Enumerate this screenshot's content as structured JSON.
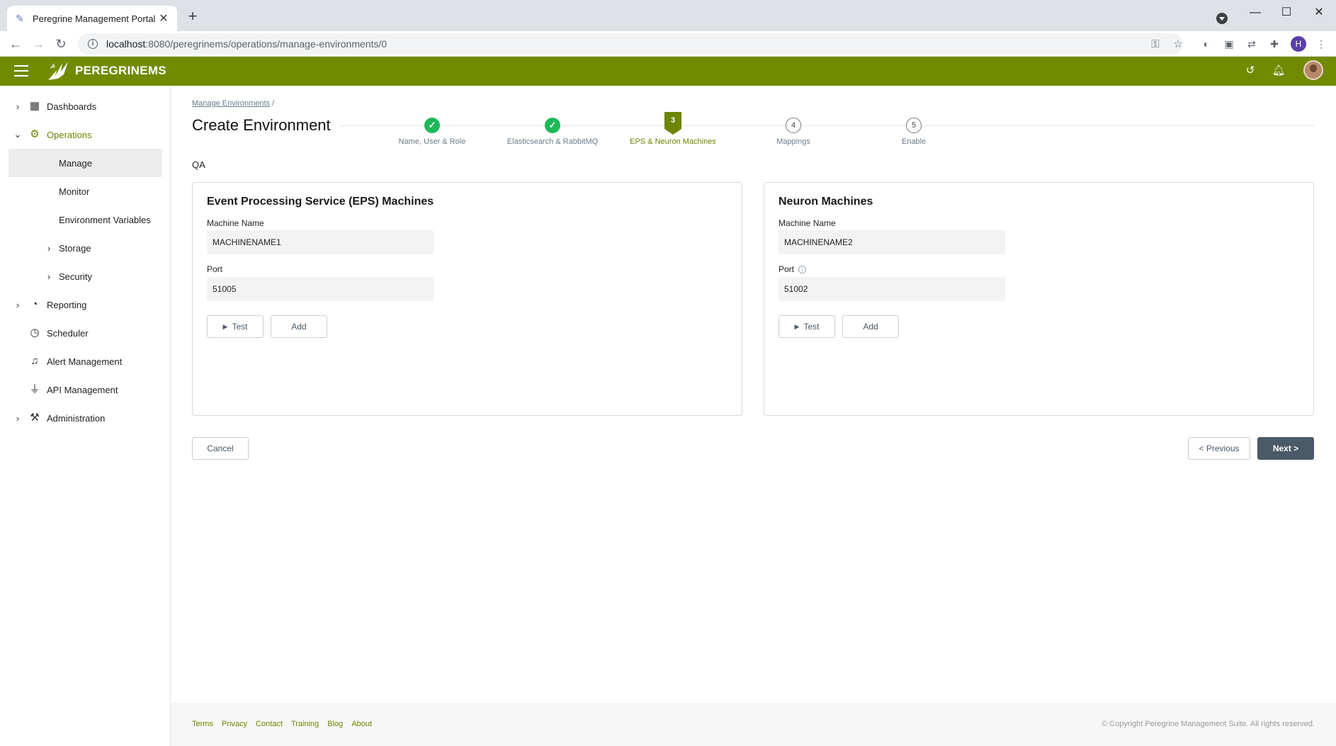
{
  "browser": {
    "tab_title": "Peregrine Management Portal",
    "tab_close": "✕",
    "new_tab": "+",
    "url_host": "localhost",
    "url_path": ":8080/peregrinems/operations/manage-environments/0",
    "profile_initial": "H",
    "win_min": "—",
    "win_max": "☐",
    "win_close": "✕"
  },
  "header": {
    "logo_text": "PEREGRINEMS",
    "brand_color": "#718a00"
  },
  "sidebar": {
    "items": [
      {
        "label": "Dashboards",
        "icon": "dashboard-icon"
      },
      {
        "label": "Operations",
        "icon": "gear-icon"
      },
      {
        "label": "Manage"
      },
      {
        "label": "Monitor"
      },
      {
        "label": "Environment Variables"
      },
      {
        "label": "Storage"
      },
      {
        "label": "Security"
      },
      {
        "label": "Reporting",
        "icon": "reporting-icon"
      },
      {
        "label": "Scheduler",
        "icon": "clock-icon"
      },
      {
        "label": "Alert Management",
        "icon": "bell-icon"
      },
      {
        "label": "API Management",
        "icon": "plug-icon"
      },
      {
        "label": "Administration",
        "icon": "wrench-icon"
      }
    ]
  },
  "main": {
    "breadcrumb_link": "Manage Environments",
    "breadcrumb_sep": "/",
    "title": "Create Environment",
    "environment_name": "QA",
    "steps": [
      {
        "label": "Name, User & Role",
        "state": "done"
      },
      {
        "label": "Elasticsearch & RabbitMQ",
        "state": "done"
      },
      {
        "label": "EPS & Neuron Machines",
        "number": "3",
        "state": "current"
      },
      {
        "label": "Mappings",
        "number": "4",
        "state": "todo"
      },
      {
        "label": "Enable",
        "number": "5",
        "state": "todo"
      }
    ],
    "eps_card": {
      "title": "Event Processing Service (EPS) Machines",
      "machine_label": "Machine Name",
      "machine_value": "MACHINENAME1",
      "port_label": "Port",
      "port_value": "51005",
      "test_label": "Test",
      "add_label": "Add"
    },
    "neuron_card": {
      "title": "Neuron Machines",
      "machine_label": "Machine Name",
      "machine_value": "MACHINENAME2",
      "port_label": "Port",
      "port_value": "51002",
      "test_label": "Test",
      "add_label": "Add"
    },
    "cancel_label": "Cancel",
    "previous_label": "< Previous",
    "next_label": "Next >"
  },
  "footer": {
    "links": [
      "Terms",
      "Privacy",
      "Contact",
      "Training",
      "Blog",
      "About"
    ],
    "copyright": "© Copyright Peregrine Management Suite. All rights reserved."
  }
}
